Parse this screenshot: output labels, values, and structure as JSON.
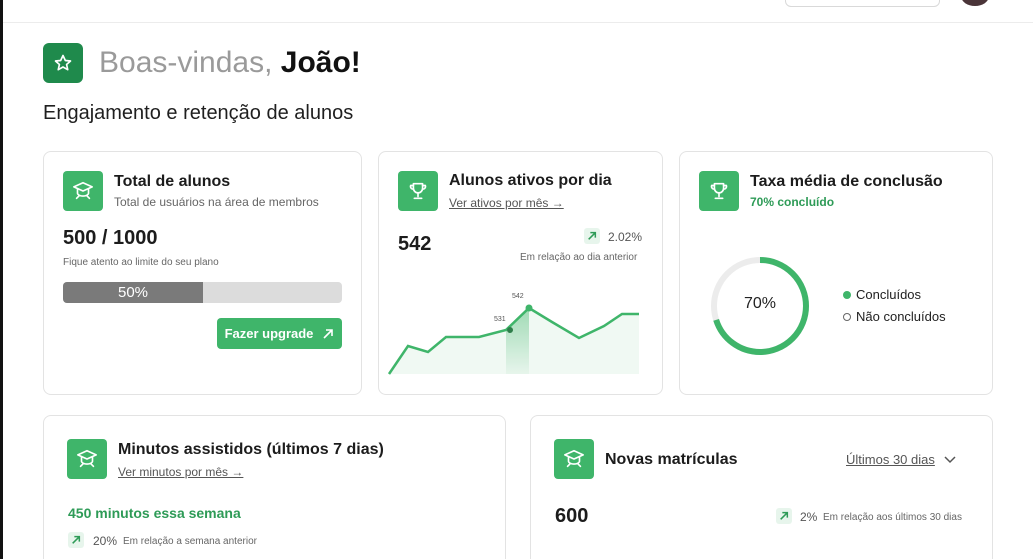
{
  "header": {
    "greeting": "Boas-vindas,",
    "user_name": "João!"
  },
  "section_title": "Engajamento e retenção de alunos",
  "cards": {
    "total_alunos": {
      "title": "Total de alunos",
      "subtitle": "Total de usuários na área de membros",
      "value": "500 / 1000",
      "note": "Fique atento ao limite do seu plano",
      "progress_label": "50%",
      "progress_fraction": 0.5,
      "button_label": "Fazer upgrade"
    },
    "ativos_dia": {
      "title": "Alunos ativos por dia",
      "link": "Ver ativos por mês →",
      "value": "542",
      "change": "2.02%",
      "change_note": "Em relação ao dia anterior",
      "point_labels": {
        "current": "542",
        "previous": "531"
      }
    },
    "taxa_conclusao": {
      "title": "Taxa média de conclusão",
      "subtitle": "70% concluído",
      "donut_label": "70%",
      "donut_fraction": 0.7,
      "legend_done": "Concluídos",
      "legend_not_done": "Não concluídos"
    },
    "minutos": {
      "title": "Minutos assistidos (últimos 7 dias)",
      "link": "Ver minutos por mês →",
      "highlight": "450 minutos essa semana",
      "change": "20%",
      "change_note": "Em relação a semana anterior"
    },
    "matriculas": {
      "title": "Novas matrículas",
      "period_selected": "Últimos 30 dias",
      "value": "600",
      "change": "2%",
      "change_note": "Em relação aos últimos 30 dias"
    }
  },
  "colors": {
    "accent": "#3fb56a",
    "accent_dark": "#1f8a4c",
    "positive_text": "#2e9b57",
    "progress_fill": "#7a7a7a",
    "track": "#dcdcdc"
  }
}
